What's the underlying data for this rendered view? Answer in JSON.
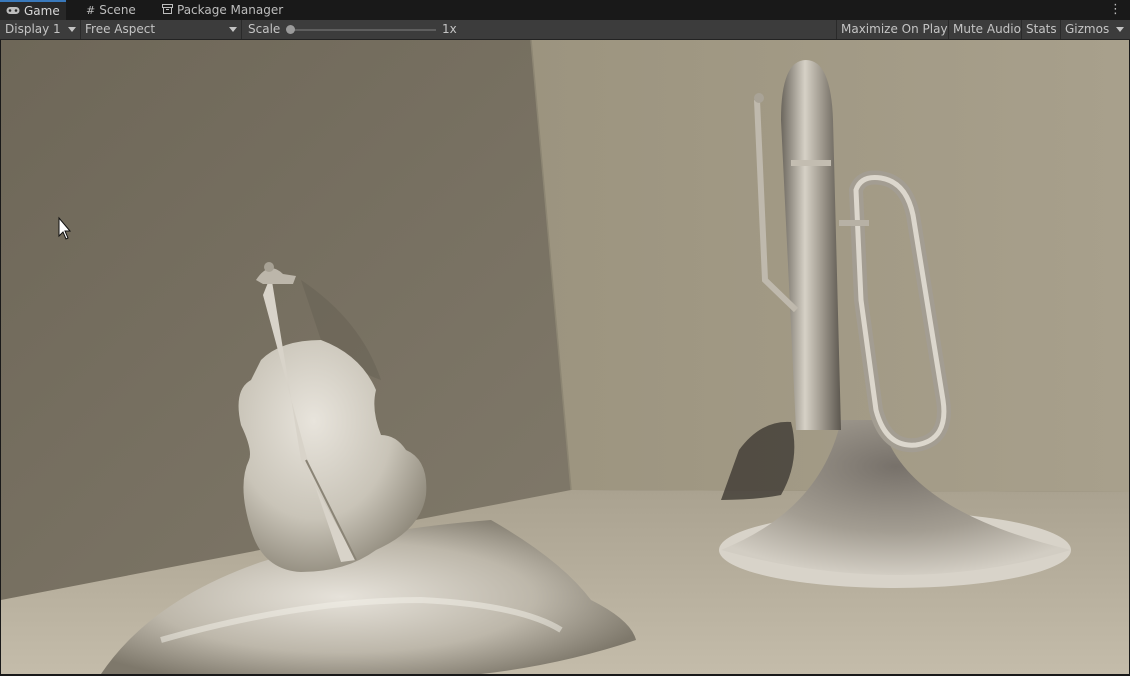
{
  "tabs": [
    {
      "label": "Game",
      "icon": "gamepad-icon",
      "active": true
    },
    {
      "label": "Scene",
      "icon": "hash-grid-icon",
      "active": false
    },
    {
      "label": "Package Manager",
      "icon": "package-icon",
      "active": false
    }
  ],
  "toolbar": {
    "display": "Display 1",
    "aspect": "Free Aspect",
    "scale_label": "Scale",
    "scale_value": "1x",
    "scale_fraction": 0,
    "buttons": [
      "Maximize On Play",
      "Mute Audio",
      "Stats",
      "Gizmos"
    ]
  },
  "colors": {
    "accent": "#3a79bb",
    "toolbar": "#3c3c3c",
    "tabbar": "#191919"
  }
}
